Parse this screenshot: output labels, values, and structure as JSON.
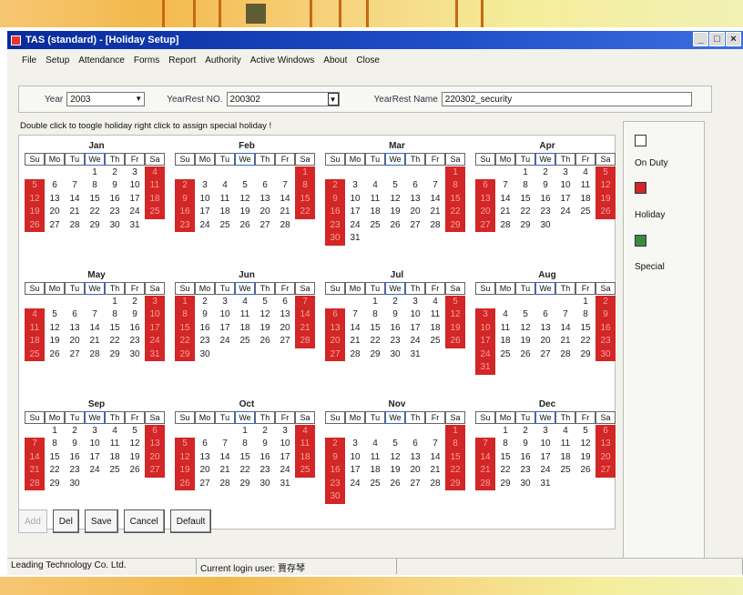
{
  "window": {
    "title": "TAS (standard) - [Holiday Setup]",
    "controls": [
      "_",
      "□",
      "×"
    ]
  },
  "menu": [
    "File",
    "Setup",
    "Attendance",
    "Forms",
    "Report",
    "Authority",
    "Active Windows",
    "About",
    "Close"
  ],
  "toolbar": {
    "year_label": "Year",
    "year_value": "2003",
    "yearrest_no_label": "YearRest NO.",
    "yearrest_no_value": "200302",
    "yearrest_name_label": "YearRest Name",
    "yearrest_name_value": "220302_security"
  },
  "hint": "Double click to toogle holiday right click to assign special holiday !",
  "weekday_headers": [
    "Su",
    "Mo",
    "Tu",
    "We",
    "Th",
    "Fr",
    "Sa"
  ],
  "months": [
    {
      "name": "Jan",
      "start": 3,
      "days": 31
    },
    {
      "name": "Feb",
      "start": 6,
      "days": 28
    },
    {
      "name": "Mar",
      "start": 6,
      "days": 31
    },
    {
      "name": "Apr",
      "start": 2,
      "days": 30
    },
    {
      "name": "May",
      "start": 4,
      "days": 31
    },
    {
      "name": "Jun",
      "start": 0,
      "days": 30
    },
    {
      "name": "Jul",
      "start": 2,
      "days": 31
    },
    {
      "name": "Aug",
      "start": 5,
      "days": 31
    },
    {
      "name": "Sep",
      "start": 1,
      "days": 30
    },
    {
      "name": "Oct",
      "start": 3,
      "days": 31
    },
    {
      "name": "Nov",
      "start": 6,
      "days": 30
    },
    {
      "name": "Dec",
      "start": 1,
      "days": 31
    }
  ],
  "legend": {
    "on_duty": "On Duty",
    "holiday": "Holiday",
    "special": "Special"
  },
  "buttons": {
    "add": "Add",
    "del": "Del",
    "save": "Save",
    "cancel": "Cancel",
    "default": "Default"
  },
  "status": {
    "company": "Leading Technology Co. Ltd.",
    "login": "Current login user: 賈存琴"
  },
  "colors": {
    "holiday": "#d32626",
    "special": "#3b8a43"
  }
}
